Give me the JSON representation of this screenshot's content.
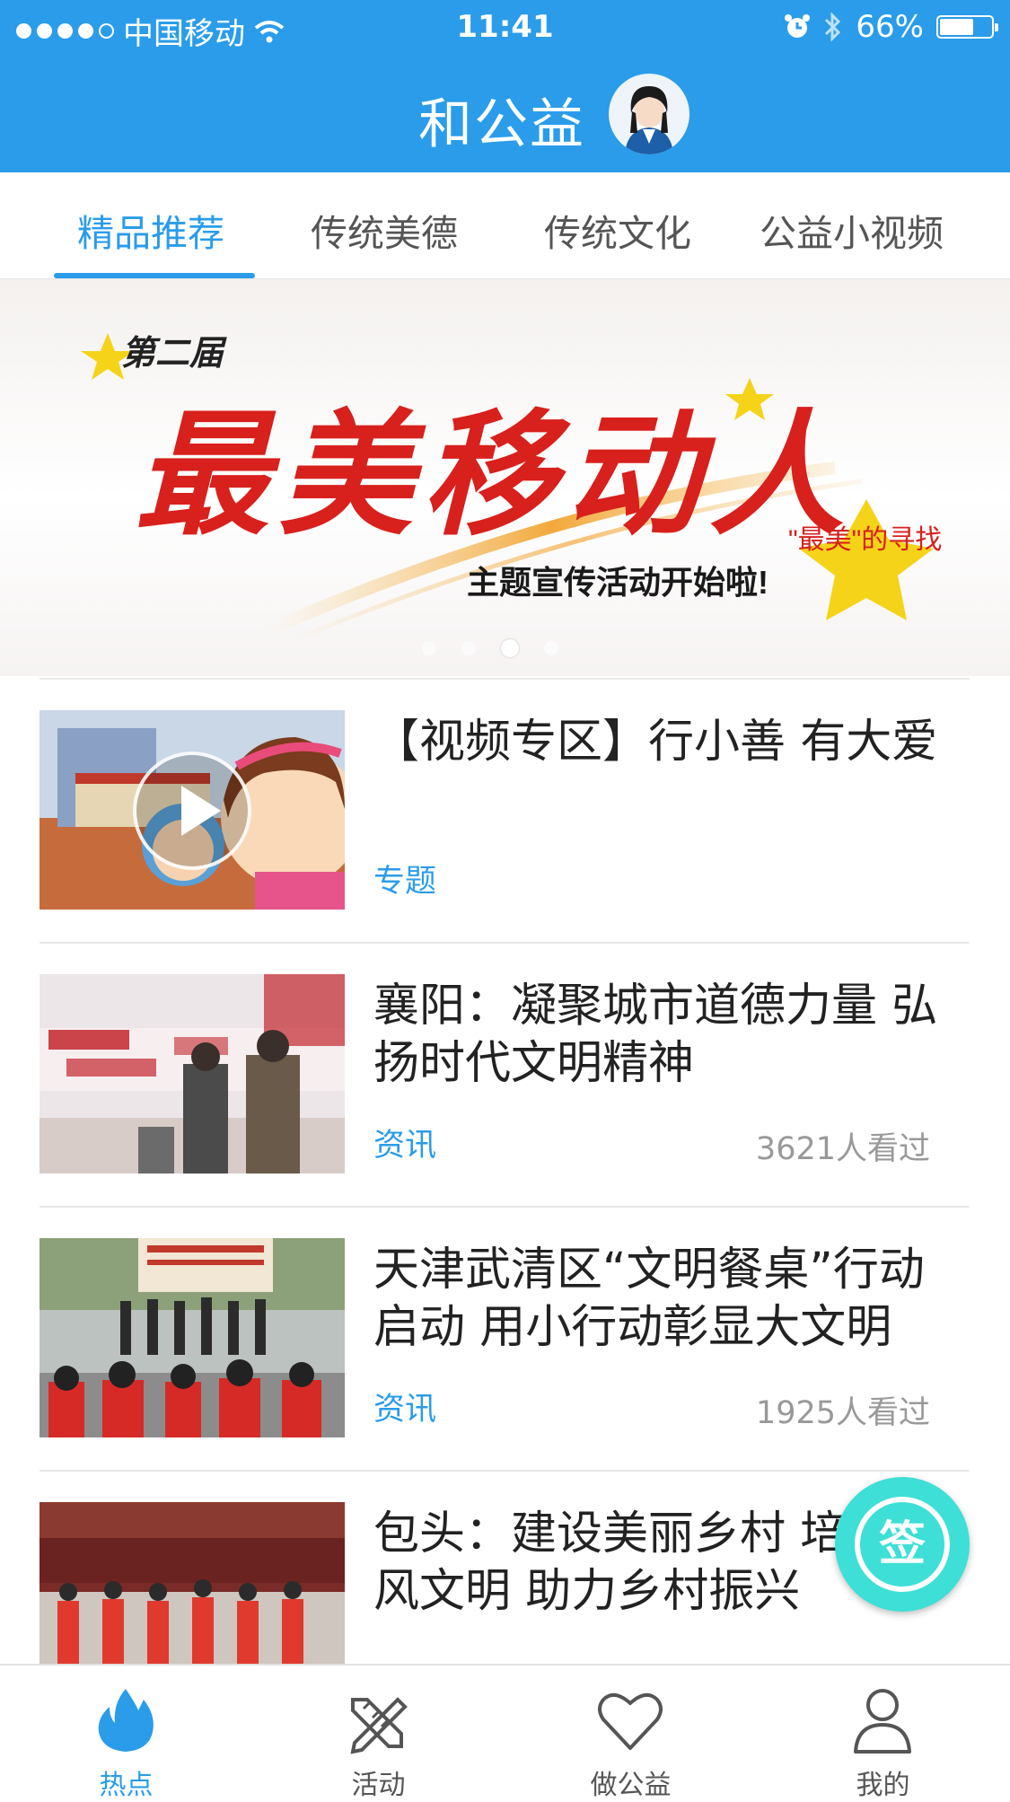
{
  "status_bar": {
    "carrier": "中国移动",
    "time": "11:41",
    "battery_text": "66%",
    "battery_level": 0.66
  },
  "header": {
    "title": "和公益"
  },
  "tabs": [
    {
      "label": "精品推荐",
      "active": true
    },
    {
      "label": "传统美德",
      "active": false
    },
    {
      "label": "传统文化",
      "active": false
    },
    {
      "label": "公益小视频",
      "active": false
    }
  ],
  "banner": {
    "edition": "第二届",
    "headline": "最美移动人",
    "subtitle": "主题宣传活动开始啦!",
    "badge": "\"最美\"的寻找",
    "dots_count": 4,
    "active_dot": 2
  },
  "articles": [
    {
      "title": "【视频专区】行小善 有大爱",
      "tag": "专题",
      "views": "",
      "video": true
    },
    {
      "title": "襄阳：凝聚城市道德力量 弘扬时代文明精神",
      "tag": "资讯",
      "views": "3621人看过",
      "video": false
    },
    {
      "title": "天津武清区“文明餐桌”行动启动 用小行动彰显大文明",
      "tag": "资讯",
      "views": "1925人看过",
      "video": false
    },
    {
      "title": "包头：建设美丽乡村 培育乡风文明 助力乡村振兴",
      "tag": "",
      "views": "",
      "video": false
    }
  ],
  "sign_button": {
    "label": "签"
  },
  "bottom_nav": [
    {
      "label": "热点",
      "icon": "flame-icon",
      "active": true
    },
    {
      "label": "活动",
      "icon": "pencil-ruler-icon",
      "active": false
    },
    {
      "label": "做公益",
      "icon": "heart-icon",
      "active": false
    },
    {
      "label": "我的",
      "icon": "person-icon",
      "active": false
    }
  ],
  "colors": {
    "accent": "#2a9cea",
    "header_bg": "#2a9cea",
    "sign_button": "#3ddfd6",
    "banner_red": "#d8201c"
  }
}
